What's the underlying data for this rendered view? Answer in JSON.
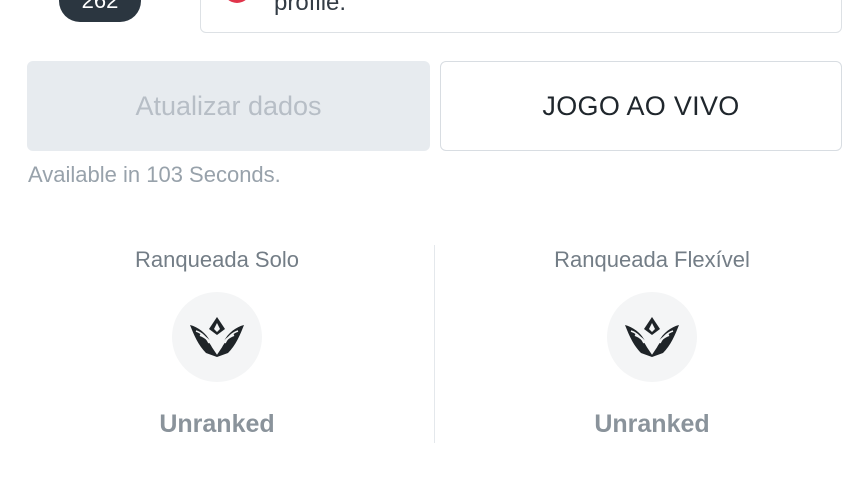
{
  "header": {
    "level": "262",
    "notice_text": "profile.",
    "notice_accent_color": "#e0344b"
  },
  "actions": {
    "refresh_label": "Atualizar dados",
    "live_game_label": "JOGO AO VIVO",
    "cooldown_text": "Available in 103 Seconds."
  },
  "ranks": [
    {
      "title": "Ranqueada Solo",
      "emblem_icon": "unranked-emblem-icon",
      "status": "Unranked"
    },
    {
      "title": "Ranqueada Flexível",
      "emblem_icon": "unranked-emblem-icon",
      "status": "Unranked"
    }
  ]
}
